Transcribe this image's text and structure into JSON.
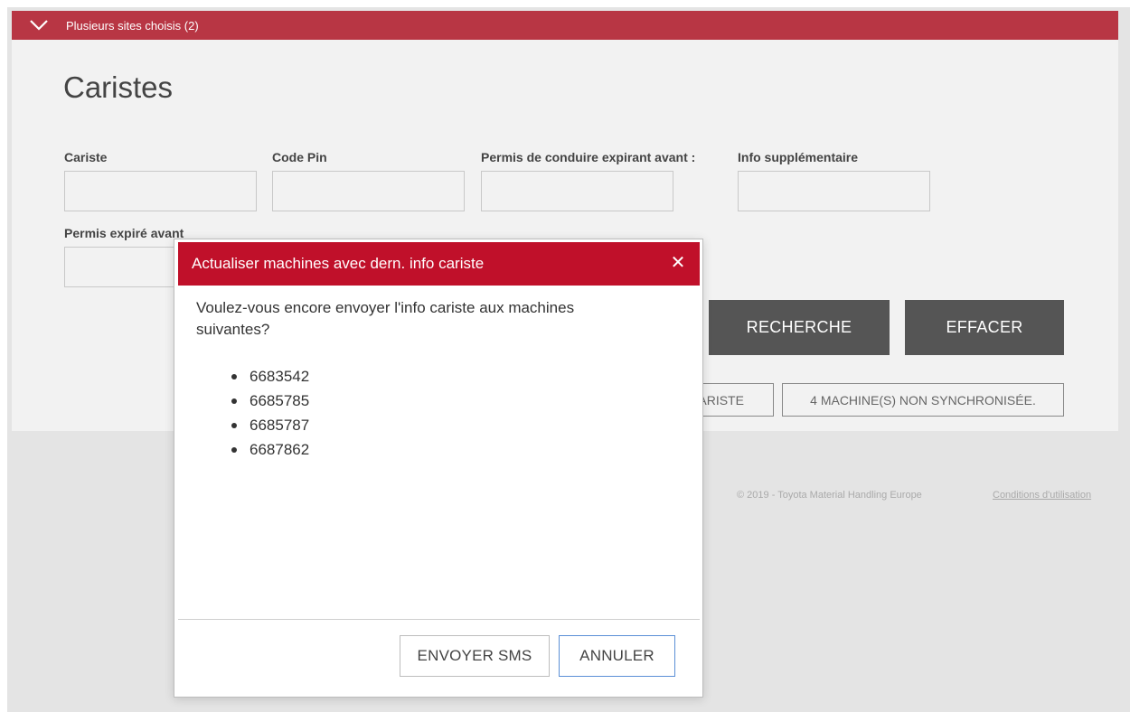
{
  "site_selector": {
    "label": "Plusieurs sites choisis (2)",
    "icon": "chevron-down-icon"
  },
  "page": {
    "title": "Caristes"
  },
  "filters": {
    "cariste_label": "Cariste",
    "code_pin_label": "Code Pin",
    "permis_expirant_label": "Permis de conduire expirant avant :",
    "info_supp_label": "Info supplémentaire",
    "permis_expire_label": "Permis expiré avant"
  },
  "actions": {
    "search_label": "RECHERCHE",
    "clear_label": "EFFACER",
    "add_cariste_label": "AJOUTER CARISTE",
    "unsynced_label": "4 MACHINE(S) NON SYNCHRONISÉE."
  },
  "footer": {
    "copyright": "© 2019 - Toyota Material Handling Europe",
    "terms_link": "Conditions d'utilisation"
  },
  "modal": {
    "title": "Actualiser machines avec dern. info cariste",
    "close_icon": "close-icon",
    "message": "Voulez-vous encore envoyer l'info cariste aux machines suivantes?",
    "machines": [
      "6683542",
      "6685785",
      "6685787",
      "6687862"
    ],
    "send_sms_label": "ENVOYER SMS",
    "cancel_label": "ANNULER"
  },
  "colors": {
    "site_bar": "#b83644",
    "modal_header": "#c0102a",
    "dark_button": "#555555",
    "page_background": "#e4e4e4",
    "panel_background": "#f2f2f2",
    "focus_border": "#5b8fd6"
  }
}
